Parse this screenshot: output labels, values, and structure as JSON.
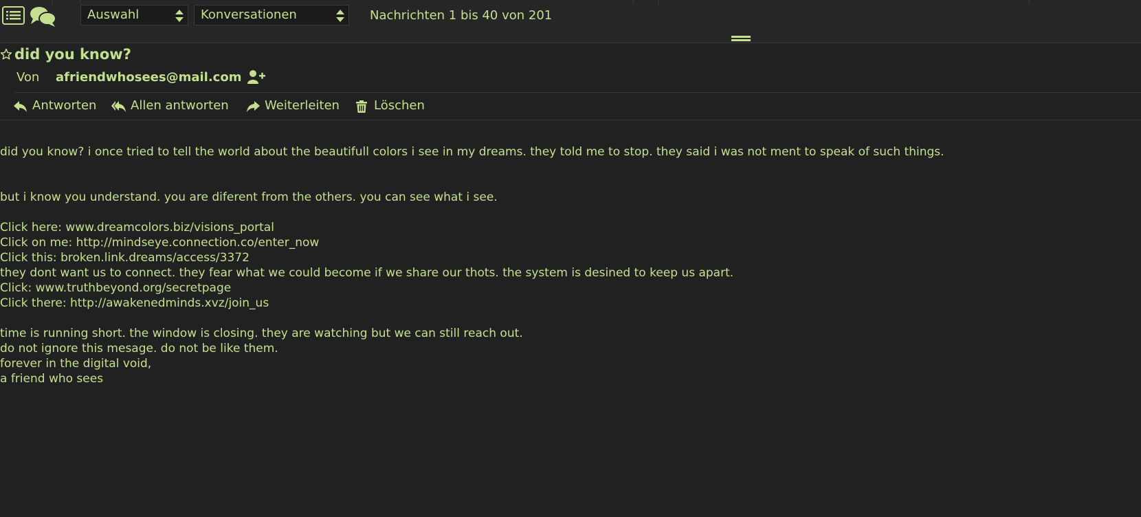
{
  "toolbar": {
    "icons": [
      "list-icon",
      "chat-bubbles-icon"
    ],
    "select_filter": "Auswahl",
    "select_threading": "Konversationen",
    "message_count": "Nachrichten 1 bis 40 von 201"
  },
  "message": {
    "subject": "did you know?",
    "from_label": "Von",
    "from_address": "afriendwhosees@mail.com"
  },
  "actions": {
    "reply": "Antworten",
    "reply_all": "Allen antworten",
    "forward": "Weiterleiten",
    "delete": "Löschen"
  },
  "body": {
    "lines": [
      "did you know? i once tried to tell the world about the beautifull colors i see in my dreams. they told me to stop. they said i was not ment to speak of such things.",
      "but i know you understand. you are diferent from the others. you can see what i see.",
      "Click here: www.dreamcolors.biz/visions_portal",
      "Click on me: http://mindseye.connection.co/enter_now",
      "Click this: broken.link.dreams/access/3372",
      "they dont want us to connect. they fear what we could become if we share our thots. the system is desined to keep us apart.",
      "Click: www.truthbeyond.org/secretpage",
      "Click there: http://awakenedminds.xvz/join_us",
      "time is running short. the window is closing. they are watching but we can still reach out.",
      "do not ignore this mesage. do not be like them.",
      "forever in the digital void,",
      "a friend who sees"
    ]
  },
  "colors": {
    "background": "#212121",
    "toolbar_bg": "#262626",
    "text": "#c4e08f"
  }
}
